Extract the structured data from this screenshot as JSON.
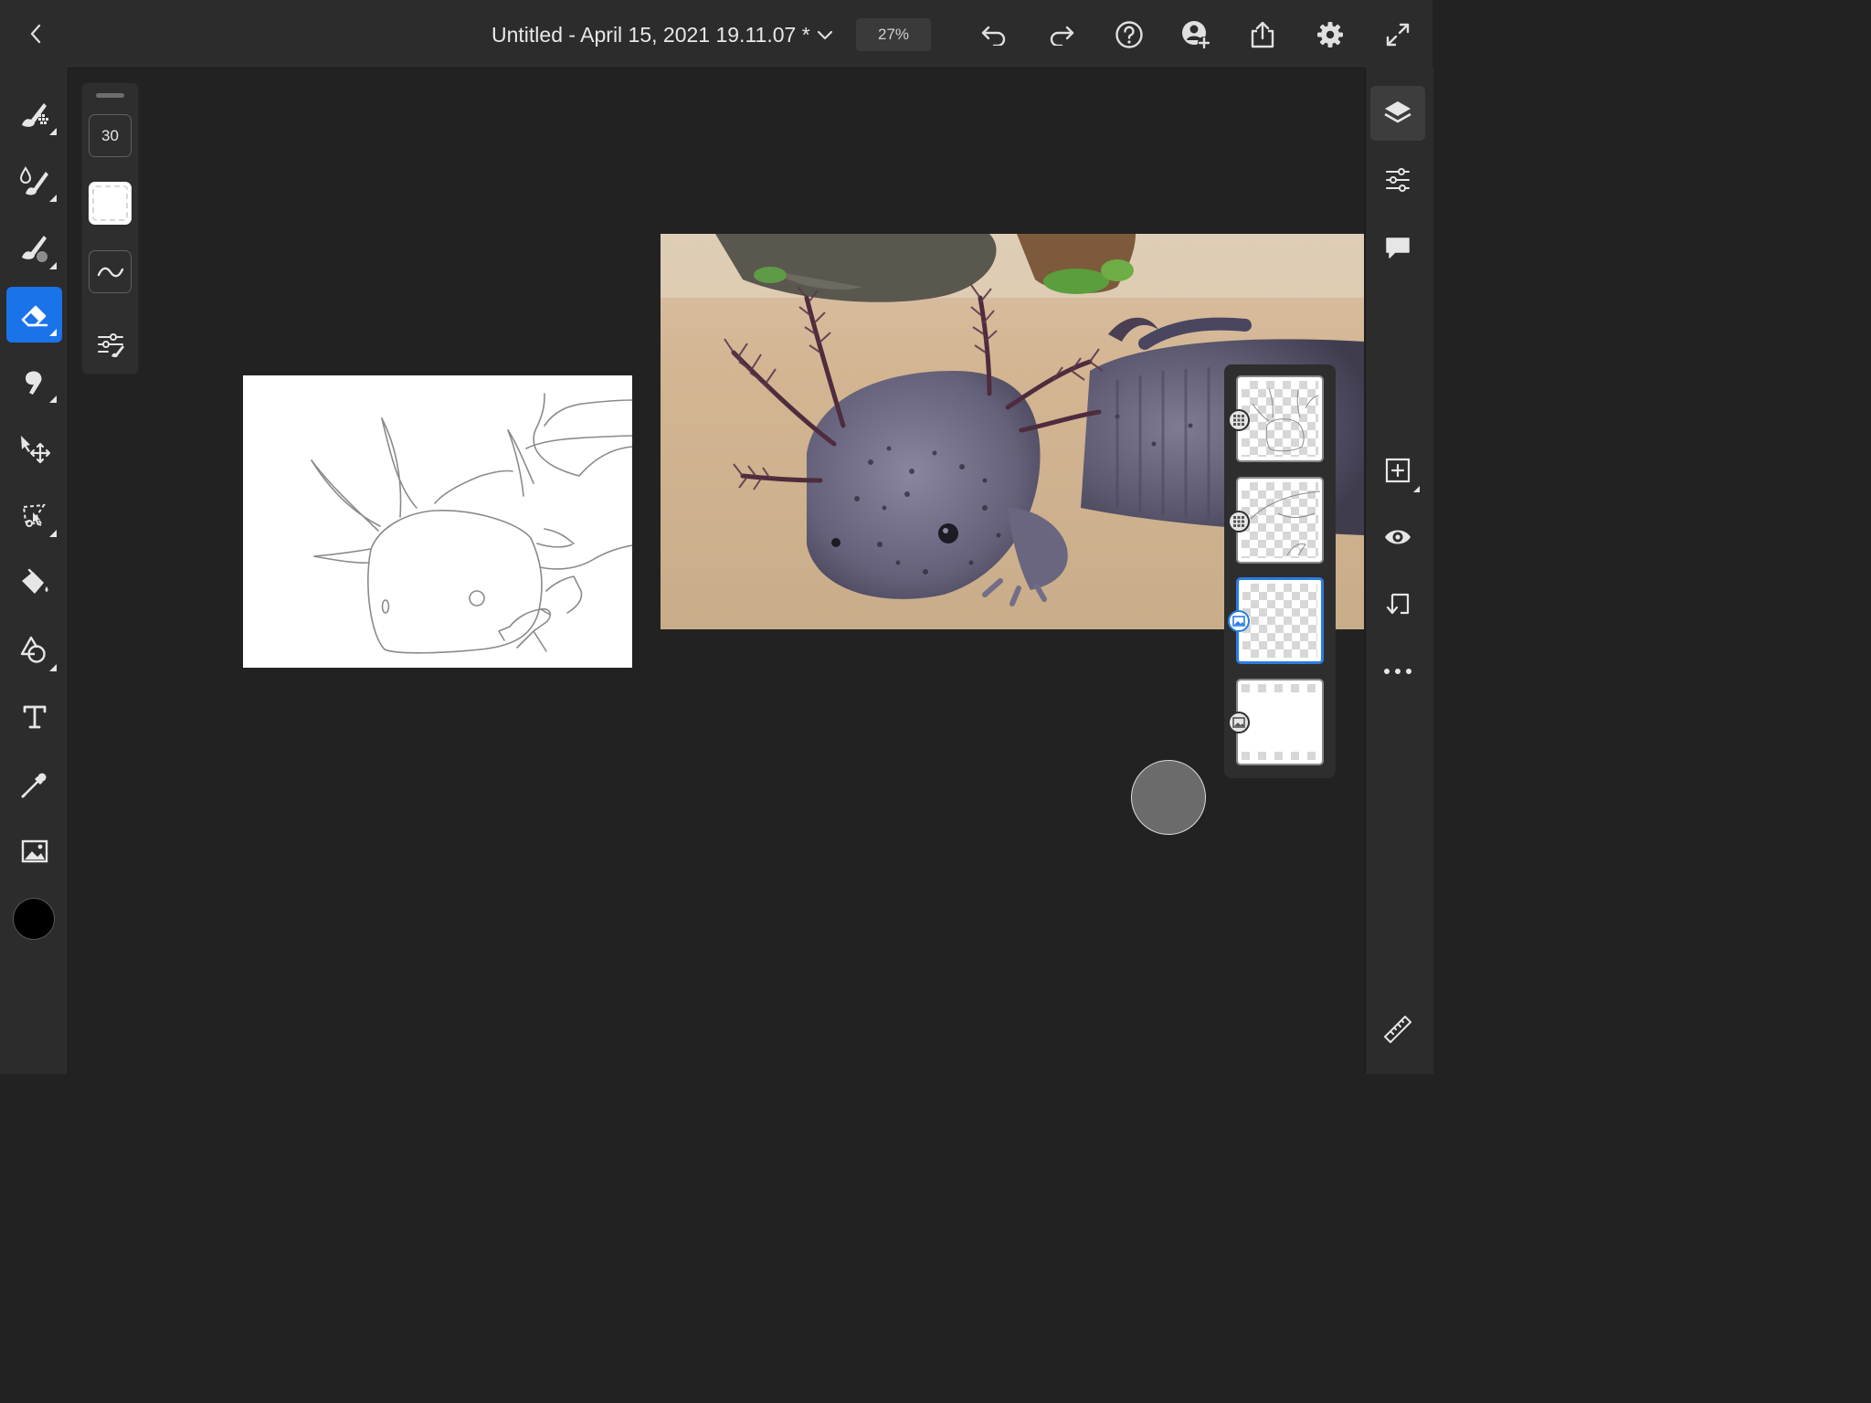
{
  "header": {
    "back_icon": "chevron-left-icon",
    "document_title": "Untitled - April 15, 2021 19.11.07 *",
    "title_dropdown_icon": "chevron-down-icon",
    "zoom_level": "27%",
    "actions": [
      "undo-icon",
      "redo-icon",
      "help-icon",
      "invite-icon",
      "share-icon",
      "settings-icon",
      "fullscreen-icon"
    ]
  },
  "tools": {
    "items": [
      "pixel-brush-icon",
      "live-brush-icon",
      "vector-brush-icon",
      "eraser-icon",
      "smudge-icon",
      "move-icon",
      "lasso-icon",
      "fill-icon",
      "shapes-icon",
      "text-icon",
      "eyedropper-icon",
      "image-icon"
    ],
    "active_tool": "eraser-icon",
    "current_color": "#000000"
  },
  "brush_panel": {
    "size": "30",
    "smoothing_icon": "tilde-icon",
    "settings_icon": "brush-settings-icon"
  },
  "right_panel": {
    "items": [
      "layers-icon",
      "layer-properties-icon",
      "comments-icon",
      "add-layer-icon",
      "visibility-icon",
      "merge-down-icon",
      "more-icon"
    ],
    "active_item": "layers-icon",
    "bottom_icon": "ruler-icon"
  },
  "layers": [
    {
      "thumbnail": "axolotl-sketch-head",
      "type": "pixel",
      "selected": false
    },
    {
      "thumbnail": "axolotl-sketch-body",
      "type": "pixel",
      "selected": false
    },
    {
      "thumbnail": "transparent",
      "type": "image",
      "selected": true
    },
    {
      "thumbnail": "white-background",
      "type": "image",
      "selected": false
    }
  ],
  "colors": {
    "accent": "#1a73e8",
    "selection": "#2a7de1",
    "chrome": "#2c2c2c",
    "canvas_bg": "#222222"
  }
}
